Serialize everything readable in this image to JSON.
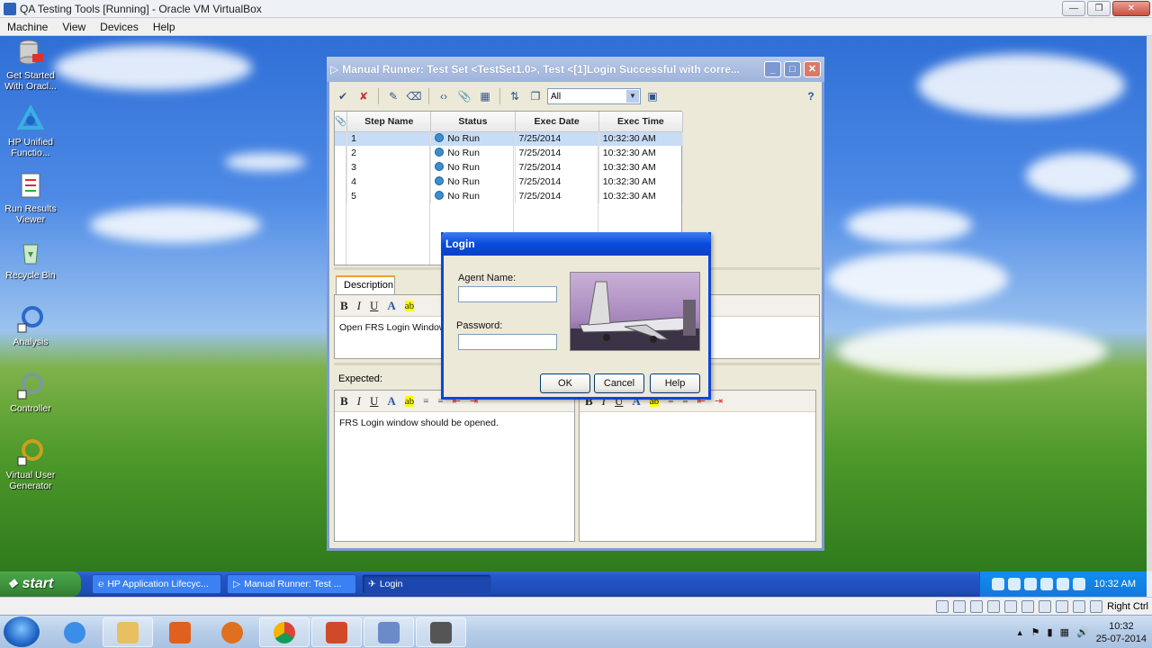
{
  "host": {
    "title": "QA Testing Tools [Running] - Oracle VM VirtualBox",
    "menu": [
      "Machine",
      "View",
      "Devices",
      "Help"
    ],
    "status_right": "Right Ctrl"
  },
  "desktop_icons": [
    {
      "label": "Get Started With Oracl...",
      "icon": "oracle-db-icon"
    },
    {
      "label": "HP Unified Functio...",
      "icon": "hp-uft-icon"
    },
    {
      "label": "Run Results Viewer",
      "icon": "run-results-icon"
    },
    {
      "label": "Recycle Bin",
      "icon": "recycle-bin-icon"
    },
    {
      "label": "Analysis",
      "icon": "analysis-icon"
    },
    {
      "label": "Controller",
      "icon": "controller-icon"
    },
    {
      "label": "Virtual User Generator",
      "icon": "vugen-icon"
    }
  ],
  "runner": {
    "title": "Manual Runner: Test Set <TestSet1.0>, Test <[1]Login Successful with corre...",
    "filter": "All",
    "columns": [
      "Step Name",
      "Status",
      "Exec Date",
      "Exec Time"
    ],
    "rows": [
      {
        "step": "1",
        "status": "No Run",
        "date": "7/25/2014",
        "time": "10:32:30 AM"
      },
      {
        "step": "2",
        "status": "No Run",
        "date": "7/25/2014",
        "time": "10:32:30 AM"
      },
      {
        "step": "3",
        "status": "No Run",
        "date": "7/25/2014",
        "time": "10:32:30 AM"
      },
      {
        "step": "4",
        "status": "No Run",
        "date": "7/25/2014",
        "time": "10:32:30 AM"
      },
      {
        "step": "5",
        "status": "No Run",
        "date": "7/25/2014",
        "time": "10:32:30 AM"
      }
    ],
    "description_tab": "Description",
    "description_text": "Open FRS Login Window",
    "expected_label": "Expected:",
    "expected_text": "FRS Login window should be opened.",
    "rte": {
      "bold": "B",
      "italic": "I",
      "underline": "U",
      "color": "A",
      "highlight": "ab"
    }
  },
  "login": {
    "title": "Login",
    "agent_label": "Agent Name:",
    "agent_value": "",
    "password_label": "Password:",
    "password_value": "",
    "ok": "OK",
    "cancel": "Cancel",
    "help": "Help"
  },
  "xp_taskbar": {
    "start": "start",
    "tasks": [
      "HP Application Lifecyc...",
      "Manual Runner: Test ...",
      "Login"
    ],
    "clock": "10:32 AM"
  },
  "w7_taskbar": {
    "time": "10:32",
    "date": "25-07-2014"
  }
}
